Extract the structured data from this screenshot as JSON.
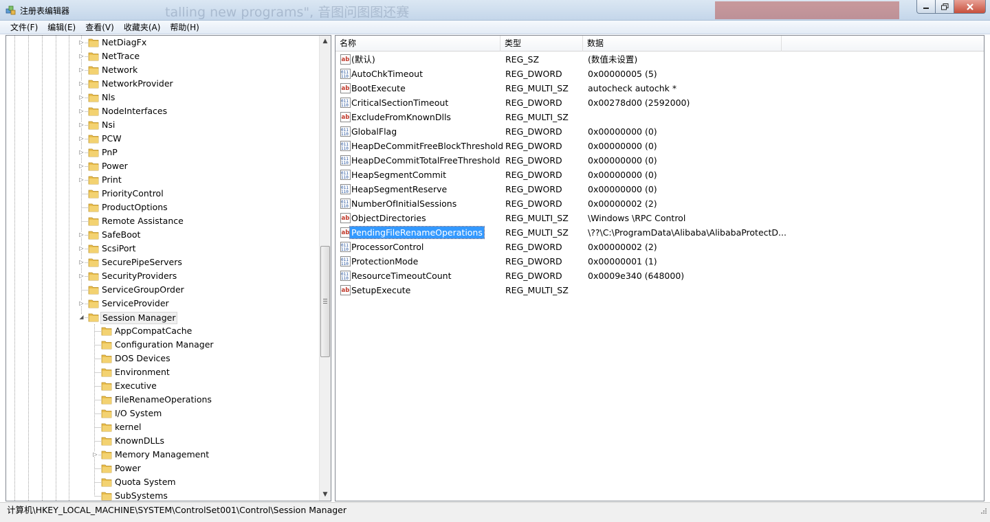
{
  "window": {
    "title": "注册表编辑器",
    "background_ghost_text": "talling new programs\", 音图问图图还赛"
  },
  "menu": [
    {
      "label": "文件(F)"
    },
    {
      "label": "编辑(E)"
    },
    {
      "label": "查看(V)"
    },
    {
      "label": "收藏夹(A)"
    },
    {
      "label": "帮助(H)"
    }
  ],
  "tree": {
    "items": [
      {
        "label": "NetDiagFx",
        "level": 1,
        "expandable": true,
        "expanded": false
      },
      {
        "label": "NetTrace",
        "level": 1,
        "expandable": true,
        "expanded": false
      },
      {
        "label": "Network",
        "level": 1,
        "expandable": true,
        "expanded": false
      },
      {
        "label": "NetworkProvider",
        "level": 1,
        "expandable": true,
        "expanded": false
      },
      {
        "label": "Nls",
        "level": 1,
        "expandable": true,
        "expanded": false
      },
      {
        "label": "NodeInterfaces",
        "level": 1,
        "expandable": true,
        "expanded": false
      },
      {
        "label": "Nsi",
        "level": 1,
        "expandable": true,
        "expanded": false
      },
      {
        "label": "PCW",
        "level": 1,
        "expandable": true,
        "expanded": false
      },
      {
        "label": "PnP",
        "level": 1,
        "expandable": true,
        "expanded": false
      },
      {
        "label": "Power",
        "level": 1,
        "expandable": true,
        "expanded": false
      },
      {
        "label": "Print",
        "level": 1,
        "expandable": true,
        "expanded": false
      },
      {
        "label": "PriorityControl",
        "level": 1,
        "expandable": false,
        "expanded": false
      },
      {
        "label": "ProductOptions",
        "level": 1,
        "expandable": false,
        "expanded": false
      },
      {
        "label": "Remote Assistance",
        "level": 1,
        "expandable": false,
        "expanded": false
      },
      {
        "label": "SafeBoot",
        "level": 1,
        "expandable": true,
        "expanded": false
      },
      {
        "label": "ScsiPort",
        "level": 1,
        "expandable": true,
        "expanded": false
      },
      {
        "label": "SecurePipeServers",
        "level": 1,
        "expandable": true,
        "expanded": false
      },
      {
        "label": "SecurityProviders",
        "level": 1,
        "expandable": true,
        "expanded": false
      },
      {
        "label": "ServiceGroupOrder",
        "level": 1,
        "expandable": false,
        "expanded": false
      },
      {
        "label": "ServiceProvider",
        "level": 1,
        "expandable": true,
        "expanded": false
      },
      {
        "label": "Session Manager",
        "level": 1,
        "expandable": true,
        "expanded": true,
        "selected": true
      },
      {
        "label": "AppCompatCache",
        "level": 2,
        "expandable": false,
        "expanded": false
      },
      {
        "label": "Configuration Manager",
        "level": 2,
        "expandable": false,
        "expanded": false
      },
      {
        "label": "DOS Devices",
        "level": 2,
        "expandable": false,
        "expanded": false
      },
      {
        "label": "Environment",
        "level": 2,
        "expandable": false,
        "expanded": false
      },
      {
        "label": "Executive",
        "level": 2,
        "expandable": false,
        "expanded": false
      },
      {
        "label": "FileRenameOperations",
        "level": 2,
        "expandable": false,
        "expanded": false
      },
      {
        "label": "I/O System",
        "level": 2,
        "expandable": false,
        "expanded": false
      },
      {
        "label": "kernel",
        "level": 2,
        "expandable": false,
        "expanded": false
      },
      {
        "label": "KnownDLLs",
        "level": 2,
        "expandable": false,
        "expanded": false
      },
      {
        "label": "Memory Management",
        "level": 2,
        "expandable": true,
        "expanded": false
      },
      {
        "label": "Power",
        "level": 2,
        "expandable": false,
        "expanded": false
      },
      {
        "label": "Quota System",
        "level": 2,
        "expandable": false,
        "expanded": false
      },
      {
        "label": "SubSystems",
        "level": 2,
        "expandable": false,
        "expanded": false
      }
    ]
  },
  "list": {
    "columns": [
      {
        "label": "名称"
      },
      {
        "label": "类型"
      },
      {
        "label": "数据"
      }
    ],
    "rows": [
      {
        "name": "(默认)",
        "type": "REG_SZ",
        "data": "(数值未设置)",
        "icon": "string-value-icon"
      },
      {
        "name": "AutoChkTimeout",
        "type": "REG_DWORD",
        "data": "0x00000005 (5)",
        "icon": "binary-value-icon"
      },
      {
        "name": "BootExecute",
        "type": "REG_MULTI_SZ",
        "data": "autocheck autochk *",
        "icon": "string-value-icon"
      },
      {
        "name": "CriticalSectionTimeout",
        "type": "REG_DWORD",
        "data": "0x00278d00 (2592000)",
        "icon": "binary-value-icon"
      },
      {
        "name": "ExcludeFromKnownDlls",
        "type": "REG_MULTI_SZ",
        "data": "",
        "icon": "string-value-icon"
      },
      {
        "name": "GlobalFlag",
        "type": "REG_DWORD",
        "data": "0x00000000 (0)",
        "icon": "binary-value-icon"
      },
      {
        "name": "HeapDeCommitFreeBlockThreshold",
        "type": "REG_DWORD",
        "data": "0x00000000 (0)",
        "icon": "binary-value-icon"
      },
      {
        "name": "HeapDeCommitTotalFreeThreshold",
        "type": "REG_DWORD",
        "data": "0x00000000 (0)",
        "icon": "binary-value-icon"
      },
      {
        "name": "HeapSegmentCommit",
        "type": "REG_DWORD",
        "data": "0x00000000 (0)",
        "icon": "binary-value-icon"
      },
      {
        "name": "HeapSegmentReserve",
        "type": "REG_DWORD",
        "data": "0x00000000 (0)",
        "icon": "binary-value-icon"
      },
      {
        "name": "NumberOfInitialSessions",
        "type": "REG_DWORD",
        "data": "0x00000002 (2)",
        "icon": "binary-value-icon"
      },
      {
        "name": "ObjectDirectories",
        "type": "REG_MULTI_SZ",
        "data": "\\Windows \\RPC Control",
        "icon": "string-value-icon"
      },
      {
        "name": "PendingFileRenameOperations",
        "type": "REG_MULTI_SZ",
        "data": "\\??\\C:\\ProgramData\\Alibaba\\AlibabaProtectD...",
        "icon": "string-value-icon",
        "selected": true
      },
      {
        "name": "ProcessorControl",
        "type": "REG_DWORD",
        "data": "0x00000002 (2)",
        "icon": "binary-value-icon"
      },
      {
        "name": "ProtectionMode",
        "type": "REG_DWORD",
        "data": "0x00000001 (1)",
        "icon": "binary-value-icon"
      },
      {
        "name": "ResourceTimeoutCount",
        "type": "REG_DWORD",
        "data": "0x0009e340 (648000)",
        "icon": "binary-value-icon"
      },
      {
        "name": "SetupExecute",
        "type": "REG_MULTI_SZ",
        "data": "",
        "icon": "string-value-icon"
      }
    ]
  },
  "status": {
    "path": "计算机\\HKEY_LOCAL_MACHINE\\SYSTEM\\ControlSet001\\Control\\Session Manager"
  },
  "colors": {
    "selection": "#3399ff",
    "folder": "#f3d271",
    "close_button": "#c7503d"
  }
}
